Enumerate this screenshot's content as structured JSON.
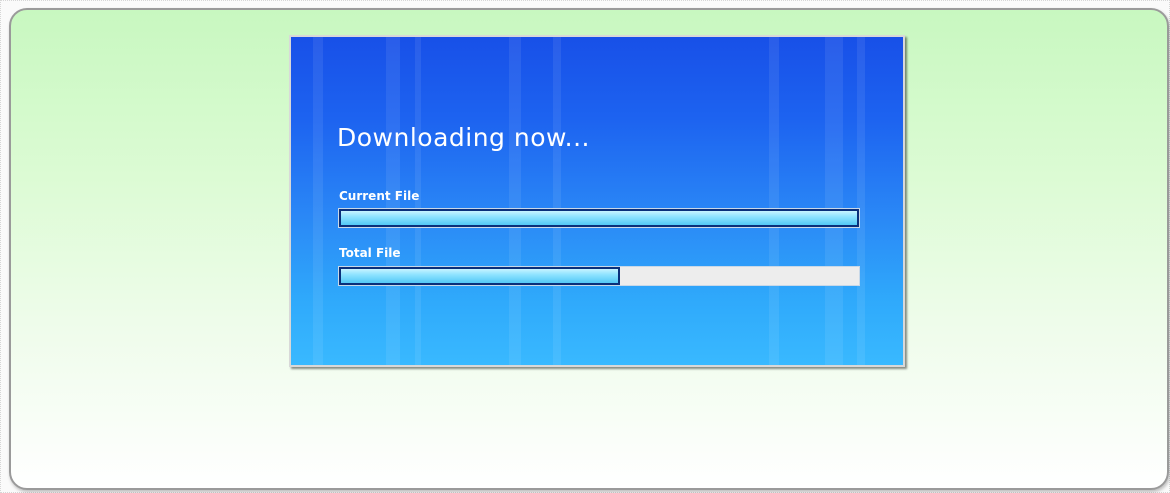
{
  "dialog": {
    "title": "Downloading now...",
    "current_file": {
      "label": "Current File",
      "progress": 1.0
    },
    "total_file": {
      "label": "Total File",
      "progress": 0.54
    }
  },
  "colors": {
    "dialog_top": "#1850e8",
    "dialog_bottom": "#39b9ff",
    "panel_green": "#c8f8c0",
    "progress_fill": "#8fe3ff",
    "progress_border": "#0a2f7a",
    "progress_track": "#ededed"
  }
}
